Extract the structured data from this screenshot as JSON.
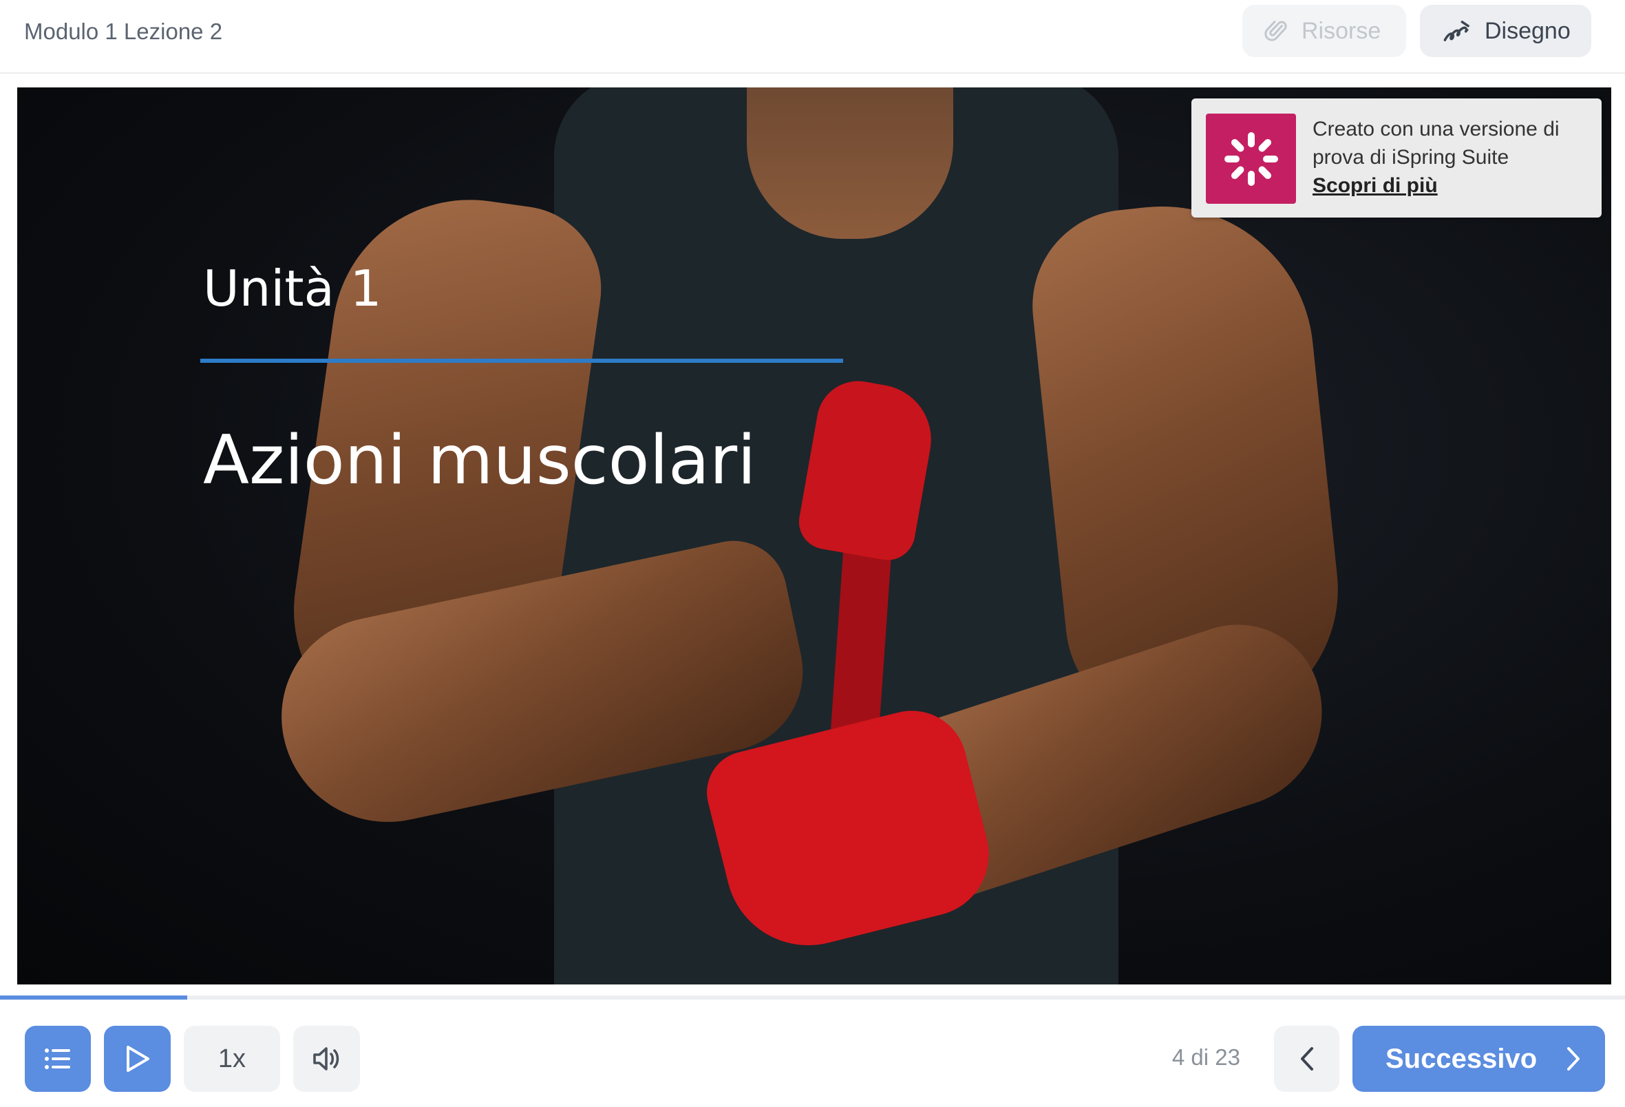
{
  "header": {
    "title": "Modulo 1 Lezione 2",
    "resources_label": "Risorse",
    "drawing_label": "Disegno"
  },
  "slide": {
    "unit_label": "Unità 1",
    "title": "Azioni muscolari",
    "image_description_icon": "bodybuilder-photo",
    "accent_color": "#2d7cc8"
  },
  "trial_banner": {
    "line1": "Creato con una versione di",
    "line2": "prova di iSpring Suite",
    "link": "Scopri di più",
    "logo_color": "#c41f62"
  },
  "progress": {
    "fraction": 0.115
  },
  "player": {
    "speed_label": "1x",
    "slide_counter": "4 di 23",
    "next_label": "Successivo",
    "accent_color": "#5b8de0"
  },
  "icons": {
    "menu": "list-icon",
    "play": "play-icon",
    "volume": "volume-icon",
    "prev": "chevron-left-icon",
    "next": "chevron-right-icon",
    "resources": "paperclip-icon",
    "drawing": "squiggle-icon"
  }
}
